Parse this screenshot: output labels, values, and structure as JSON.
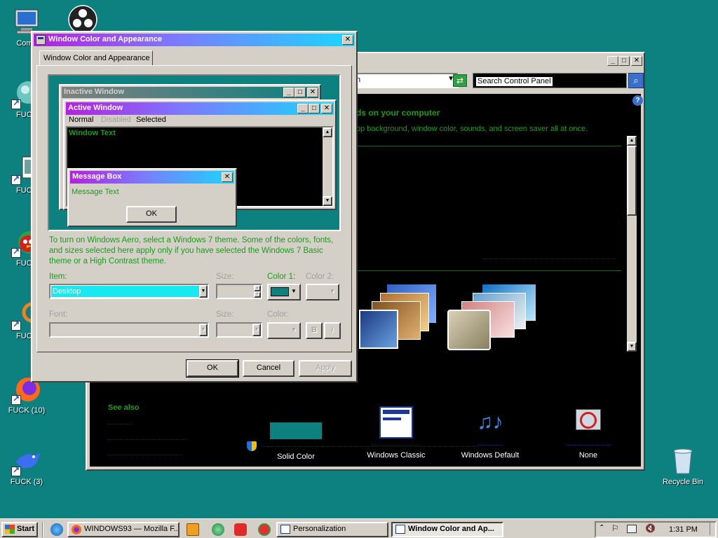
{
  "desktop": {
    "icons": [
      {
        "label": "Comp"
      },
      {
        "label": "FUCK"
      },
      {
        "label": "FUCK"
      },
      {
        "label": "FUCK"
      },
      {
        "label": "FUCK"
      },
      {
        "label": "FUCK (10)"
      },
      {
        "label": "FUCK (3)"
      },
      {
        "label": "Recycle Bin"
      }
    ]
  },
  "control_panel": {
    "address_text": "n",
    "search_placeholder": "Search Control Panel",
    "heading": "ds on your computer",
    "subheading": "op background, window color, sounds, and screen saver all at once.",
    "see_also": "See also",
    "bottom_items": [
      {
        "label": "Solid Color"
      },
      {
        "label": "Windows Classic"
      },
      {
        "label": "Windows Default"
      },
      {
        "label": "None"
      }
    ]
  },
  "dialog": {
    "title": "Window Color and Appearance",
    "tab_label": "Window Color and Appearance",
    "preview": {
      "inactive_title": "Inactive Window",
      "active_title": "Active Window",
      "menu_normal": "Normal",
      "menu_disabled": "Disabled",
      "menu_selected": "Selected",
      "window_text": "Window Text",
      "msgbox_title": "Message Box",
      "msgbox_text": "Message Text",
      "msgbox_ok": "OK"
    },
    "info_text": "To turn on Windows Aero, select a Windows 7 theme.  Some of the colors, fonts, and sizes selected here apply only if you have selected the Windows 7 Basic theme or a High Contrast theme.",
    "item_label": "Item:",
    "item_value": "Desktop",
    "size_label": "Size:",
    "color1_label": "Color 1:",
    "color2_label": "Color 2:",
    "font_label": "Font:",
    "size2_label": "Size:",
    "color_label": "Color:",
    "bold_label": "B",
    "italic_label": "I",
    "ok": "OK",
    "cancel": "Cancel",
    "apply": "Apply",
    "color1_swatch": "#0d8080"
  },
  "taskbar": {
    "start": "Start",
    "items": [
      {
        "label": "WINDOWS93 — Mozilla F..."
      },
      {
        "label": "Personalization"
      },
      {
        "label": "Window Color and Ap..."
      }
    ],
    "clock": "1:31 PM"
  },
  "colors": {
    "desktop": "#0d8080",
    "green_text": "#1a9c1a"
  }
}
